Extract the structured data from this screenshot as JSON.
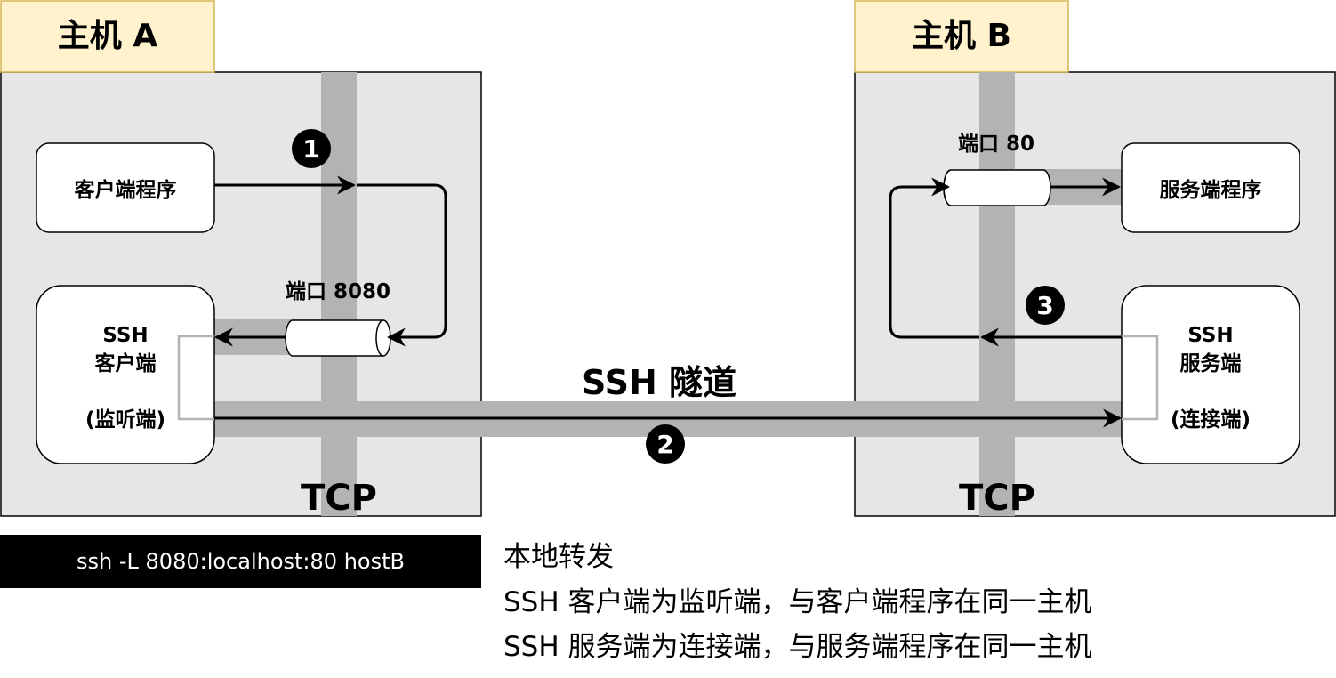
{
  "host_a": {
    "title": "主机 A",
    "layer": "TCP"
  },
  "host_b": {
    "title": "主机 B",
    "layer": "TCP"
  },
  "client_program": "客户端程序",
  "server_program": "服务端程序",
  "ssh_client": {
    "line1": "SSH",
    "line2": "客户端",
    "role": "(监听端)"
  },
  "ssh_server": {
    "line1": "SSH",
    "line2": "服务端",
    "role": "(连接端)"
  },
  "port_a": "端口 8080",
  "port_b": "端口 80",
  "tunnel_label": "SSH 隧道",
  "steps": [
    "1",
    "2",
    "3"
  ],
  "command": "ssh -L 8080:localhost:80 hostB",
  "notes": [
    "本地转发",
    "SSH 客户端为监听端，与客户端程序在同一主机",
    "SSH 服务端为连接端，与服务端程序在同一主机"
  ],
  "colors": {
    "host_bg": "#e6e6e6",
    "title_bg": "#fff2cc",
    "title_border": "#d6b656",
    "pipe": "#b3b3b3",
    "node_border": "#000000"
  }
}
